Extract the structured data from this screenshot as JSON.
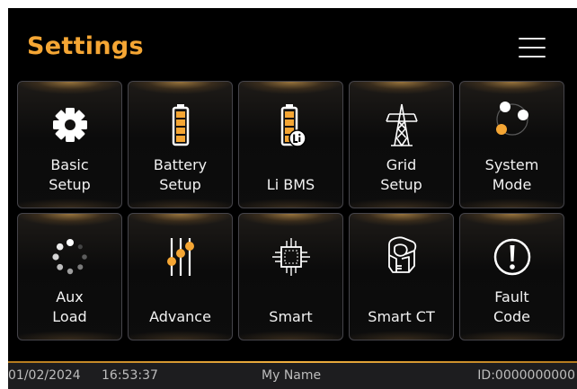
{
  "header": {
    "title": "Settings",
    "menu_icon": "hamburger-menu-icon"
  },
  "accent_color": "#f5a634",
  "tiles": [
    {
      "label": "Basic\nSetup",
      "icon": "gear-icon"
    },
    {
      "label": "Battery\nSetup",
      "icon": "battery-icon"
    },
    {
      "label": "Li BMS",
      "icon": "lithium-battery-icon"
    },
    {
      "label": "Grid\nSetup",
      "icon": "power-tower-icon"
    },
    {
      "label": "System\nMode",
      "icon": "system-mode-icon"
    },
    {
      "label": "Aux\nLoad",
      "icon": "aux-load-spinner-icon"
    },
    {
      "label": "Advance",
      "icon": "sliders-icon"
    },
    {
      "label": "Smart",
      "icon": "chip-icon"
    },
    {
      "label": "Smart CT",
      "icon": "current-transformer-icon"
    },
    {
      "label": "Fault\nCode",
      "icon": "exclamation-circle-icon"
    }
  ],
  "status_bar": {
    "date": "01/02/2024",
    "time": "16:53:37",
    "user_name": "My Name",
    "device_id": "ID:0000000000"
  }
}
